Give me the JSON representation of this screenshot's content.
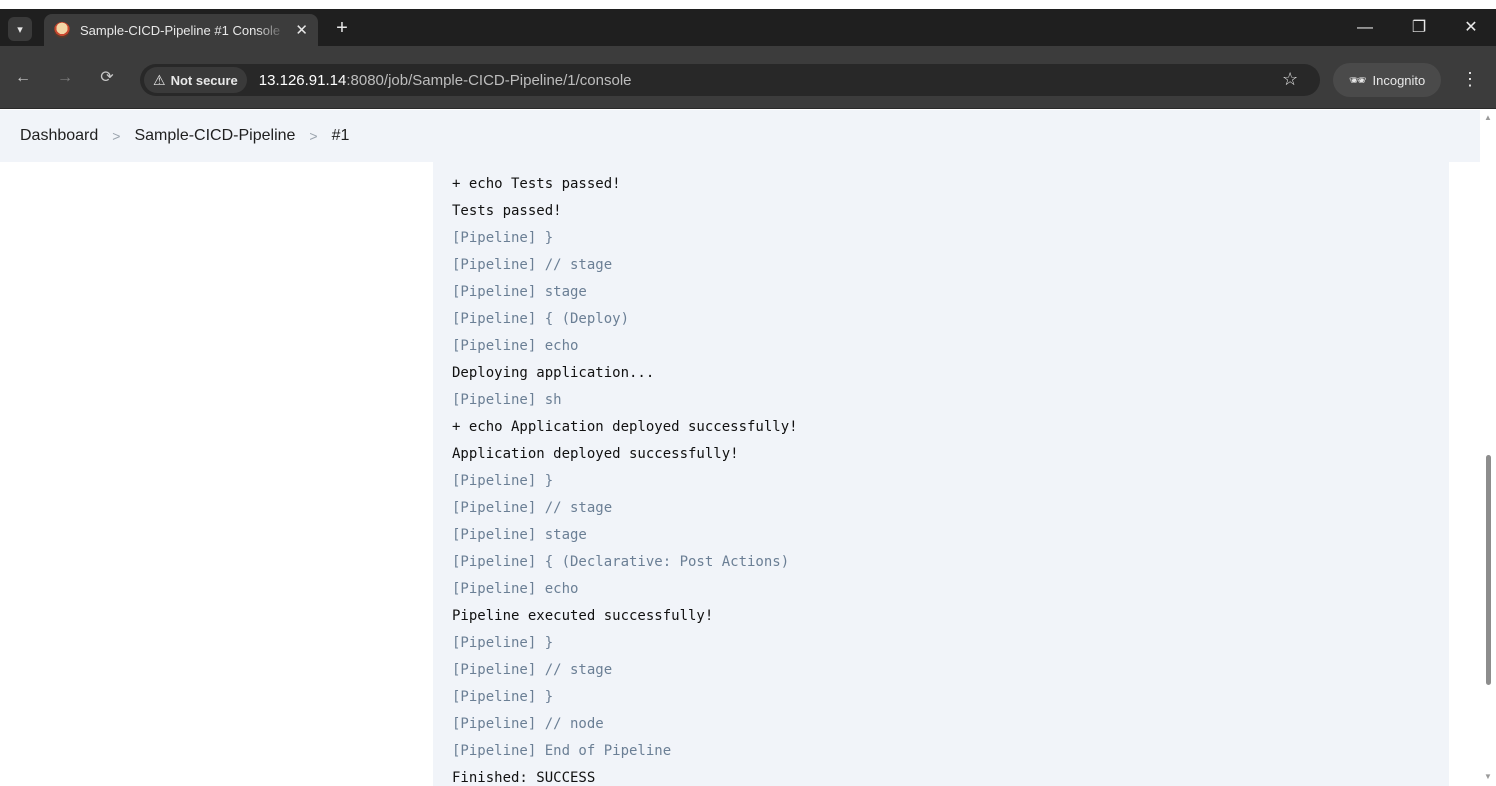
{
  "browser": {
    "tab_search_icon": "chevron-down",
    "tab_title": "Sample-CICD-Pipeline #1 Console",
    "tab_close": "✕",
    "new_tab": "+",
    "window_controls": {
      "minimize": "—",
      "restore": "❐",
      "close": "✕"
    },
    "security_label": "Not secure",
    "url_host": "13.126.91.14",
    "url_path": ":8080/job/Sample-CICD-Pipeline/1/console",
    "incognito_label": "Incognito"
  },
  "breadcrumb": {
    "items": [
      "Dashboard",
      "Sample-CICD-Pipeline",
      "#1"
    ],
    "separator": ">"
  },
  "console": {
    "lines": [
      {
        "text": "+ echo Tests passed!",
        "kind": "output"
      },
      {
        "text": "Tests passed!",
        "kind": "output"
      },
      {
        "text": "[Pipeline] }",
        "kind": "pipeline"
      },
      {
        "text": "[Pipeline] // stage",
        "kind": "pipeline"
      },
      {
        "text": "[Pipeline] stage",
        "kind": "pipeline"
      },
      {
        "text": "[Pipeline] { (Deploy)",
        "kind": "pipeline"
      },
      {
        "text": "[Pipeline] echo",
        "kind": "pipeline"
      },
      {
        "text": "Deploying application...",
        "kind": "output"
      },
      {
        "text": "[Pipeline] sh",
        "kind": "pipeline"
      },
      {
        "text": "+ echo Application deployed successfully!",
        "kind": "output"
      },
      {
        "text": "Application deployed successfully!",
        "kind": "output"
      },
      {
        "text": "[Pipeline] }",
        "kind": "pipeline"
      },
      {
        "text": "[Pipeline] // stage",
        "kind": "pipeline"
      },
      {
        "text": "[Pipeline] stage",
        "kind": "pipeline"
      },
      {
        "text": "[Pipeline] { (Declarative: Post Actions)",
        "kind": "pipeline"
      },
      {
        "text": "[Pipeline] echo",
        "kind": "pipeline"
      },
      {
        "text": "Pipeline executed successfully!",
        "kind": "output"
      },
      {
        "text": "[Pipeline] }",
        "kind": "pipeline"
      },
      {
        "text": "[Pipeline] // stage",
        "kind": "pipeline"
      },
      {
        "text": "[Pipeline] }",
        "kind": "pipeline"
      },
      {
        "text": "[Pipeline] // node",
        "kind": "pipeline"
      },
      {
        "text": "[Pipeline] End of Pipeline",
        "kind": "pipeline"
      },
      {
        "text": "Finished: SUCCESS",
        "kind": "output"
      }
    ]
  },
  "colors": {
    "pipeline_text": "#6b7f95",
    "output_text": "#111111",
    "console_bg": "#f1f4f9",
    "browser_chrome": "#3c3c3c"
  }
}
